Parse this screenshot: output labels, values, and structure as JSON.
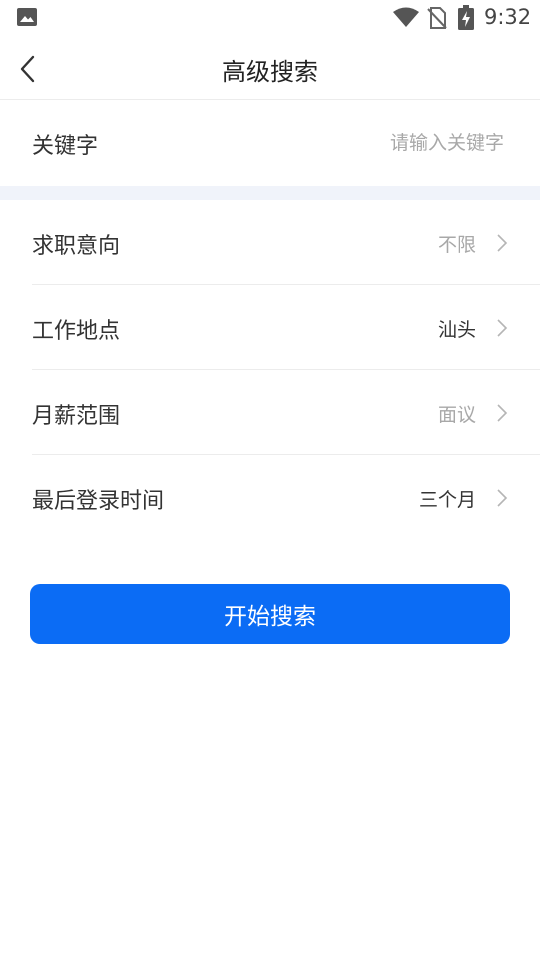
{
  "status_bar": {
    "time": "9:32",
    "icons": [
      "image-icon",
      "wifi-icon",
      "no-sim-icon",
      "battery-charging-icon"
    ]
  },
  "nav": {
    "title": "高级搜索",
    "back_icon": "chevron-left-icon"
  },
  "keyword": {
    "label": "关键字",
    "value": "",
    "placeholder": "请输入关键字"
  },
  "filters": [
    {
      "label": "求职意向",
      "value": "不限",
      "muted": true
    },
    {
      "label": "工作地点",
      "value": "汕头",
      "muted": false
    },
    {
      "label": "月薪范围",
      "value": "面议",
      "muted": true
    },
    {
      "label": "最后登录时间",
      "value": "三个月",
      "muted": false
    }
  ],
  "search_button": {
    "label": "开始搜索"
  },
  "colors": {
    "accent": "#0b6cf5",
    "muted_text": "#a8a8a8",
    "value_text": "#333333",
    "section_gap": "#f0f3fa"
  }
}
